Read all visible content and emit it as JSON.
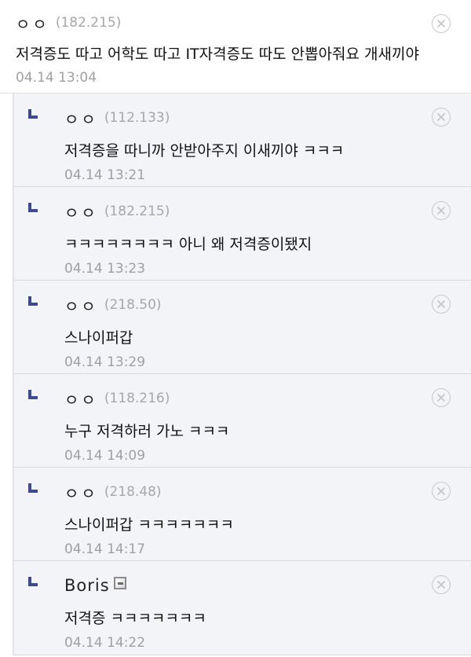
{
  "comments": [
    {
      "nick": "ㅇㅇ",
      "ip": "(182.215)",
      "text": "저격증도 따고 어학도 따고 IT자격증도 따도 안뽑아줘요 개새끼야",
      "date": "04.14 13:04",
      "delete_icon": "close-circle-icon"
    }
  ],
  "replies": [
    {
      "nick": "ㅇㅇ",
      "ip": "(112.133)",
      "text": "저격증을 따니까 안받아주지 이새끼야 ㅋㅋㅋ",
      "date": "04.14 13:21"
    },
    {
      "nick": "ㅇㅇ",
      "ip": "(182.215)",
      "text": "ㅋㅋㅋㅋㅋㅋㅋㅋ 아니 왜 저격증이됐지",
      "date": "04.14 13:23"
    },
    {
      "nick": "ㅇㅇ",
      "ip": "(218.50)",
      "text": "스나이퍼갑",
      "date": "04.14 13:29"
    },
    {
      "nick": "ㅇㅇ",
      "ip": "(118.216)",
      "text": "누구 저격하러 가노 ㅋㅋㅋ",
      "date": "04.14 14:09"
    },
    {
      "nick": "ㅇㅇ",
      "ip": "(218.48)",
      "text": "스나이퍼갑 ㅋㅋㅋㅋㅋㅋㅋ",
      "date": "04.14 14:17"
    },
    {
      "nick": "Boris",
      "ip": "",
      "member_icon": "fixed-member-icon",
      "text": "저격증 ㅋㅋㅋㅋㅋㅋㅋ",
      "date": "04.14 14:22"
    }
  ],
  "icons": {
    "reply": "reply-arrow-icon",
    "delete": "close-circle-icon"
  },
  "colors": {
    "reply_bg": "#f3f4f8",
    "reply_arrow": "#3e4a8f",
    "meta_gray": "#a0a0a0"
  }
}
